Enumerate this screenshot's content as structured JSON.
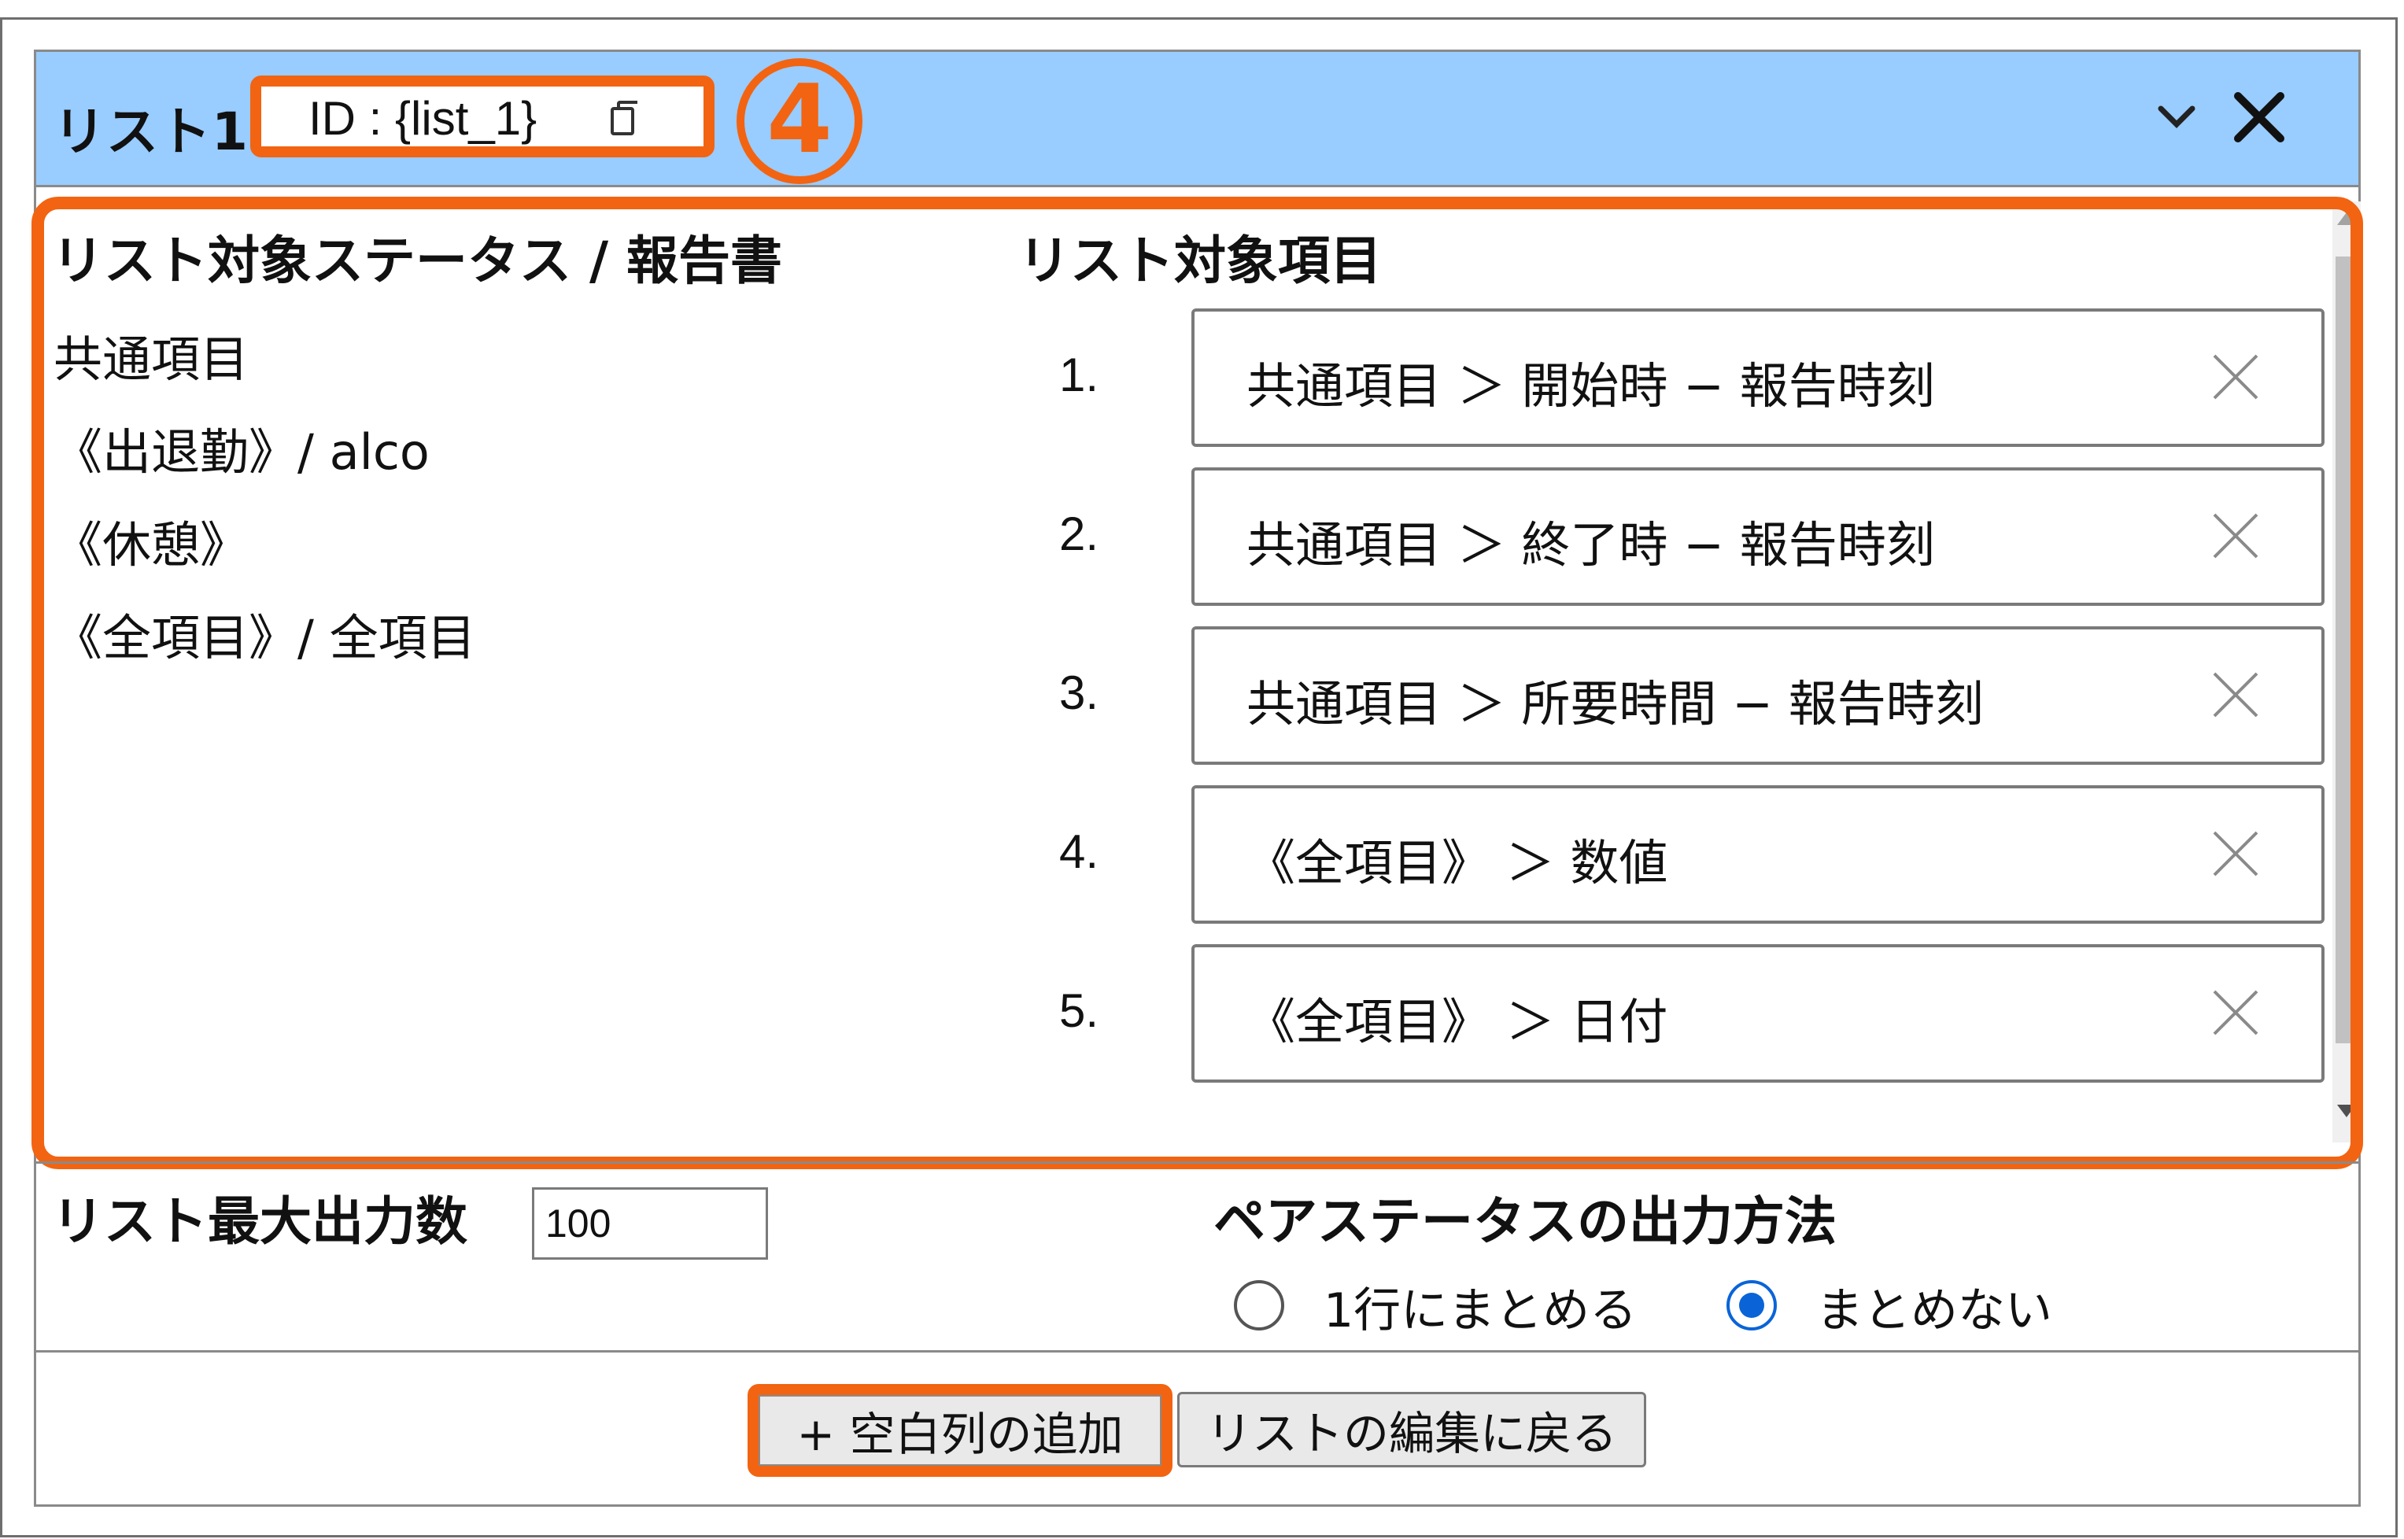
{
  "header": {
    "title": "リスト1",
    "id_text": "ID : {list_1}",
    "step_number": "4"
  },
  "left": {
    "heading": "リスト対象ステータス / 報告書",
    "statuses": [
      "共通項目",
      "《出退勤》/ alco",
      "《休憩》",
      "《全項目》/ 全項目"
    ]
  },
  "right": {
    "heading": "リスト対象項目",
    "items": [
      {
        "num": "1.",
        "label": "共通項目 ＞ 開始時 − 報告時刻"
      },
      {
        "num": "2.",
        "label": "共通項目 ＞ 終了時 − 報告時刻"
      },
      {
        "num": "3.",
        "label": "共通項目 ＞ 所要時間 − 報告時刻"
      },
      {
        "num": "4.",
        "label": "《全項目》 ＞ 数値"
      },
      {
        "num": "5.",
        "label": "《全項目》 ＞ 日付"
      }
    ]
  },
  "settings": {
    "max_output_label": "リスト最大出力数",
    "max_output_value": "100",
    "pair_label": "ペアステータスの出力方法",
    "options": [
      {
        "label": "1行にまとめる",
        "selected": false
      },
      {
        "label": "まとめない",
        "selected": true
      }
    ]
  },
  "footer": {
    "add_blank_column": "+ 空白列の追加",
    "back_to_edit": "リストの編集に戻る"
  },
  "colors": {
    "header_bg": "#99ccff",
    "highlight": "#f26411",
    "radio_selected": "#0a64d8"
  },
  "icons": [
    "copy-icon",
    "chevron-down-icon",
    "close-icon",
    "remove-icon"
  ]
}
